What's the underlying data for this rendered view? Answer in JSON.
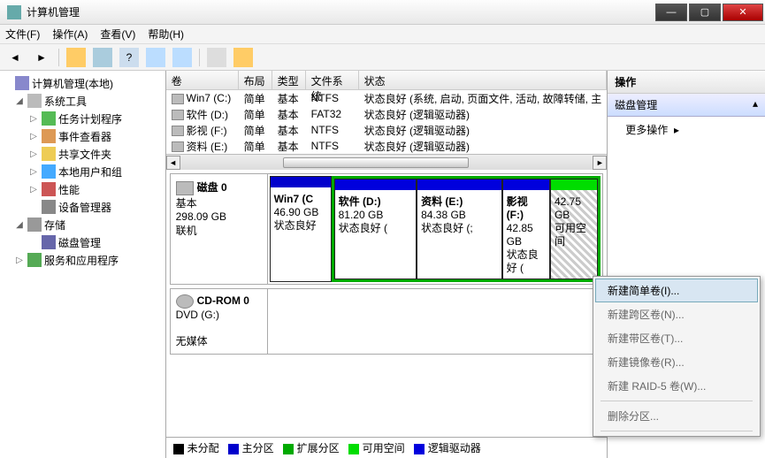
{
  "window": {
    "title": "计算机管理"
  },
  "menu": {
    "file": "文件(F)",
    "action": "操作(A)",
    "view": "查看(V)",
    "help": "帮助(H)"
  },
  "tree": {
    "root": "计算机管理(本地)",
    "system_tools": "系统工具",
    "scheduler": "任务计划程序",
    "events": "事件查看器",
    "shared": "共享文件夹",
    "users": "本地用户和组",
    "perf": "性能",
    "devmgr": "设备管理器",
    "storage": "存储",
    "diskmgmt": "磁盘管理",
    "services": "服务和应用程序"
  },
  "vol_headers": {
    "vol": "卷",
    "layout": "布局",
    "type": "类型",
    "fs": "文件系统",
    "status": "状态"
  },
  "volumes": [
    {
      "name": "Win7 (C:)",
      "layout": "简单",
      "type": "基本",
      "fs": "NTFS",
      "status": "状态良好 (系统, 启动, 页面文件, 活动, 故障转储, 主"
    },
    {
      "name": "软件 (D:)",
      "layout": "简单",
      "type": "基本",
      "fs": "FAT32",
      "status": "状态良好 (逻辑驱动器)"
    },
    {
      "name": "影视 (F:)",
      "layout": "简单",
      "type": "基本",
      "fs": "NTFS",
      "status": "状态良好 (逻辑驱动器)"
    },
    {
      "name": "资料 (E:)",
      "layout": "简单",
      "type": "基本",
      "fs": "NTFS",
      "status": "状态良好 (逻辑驱动器)"
    }
  ],
  "disk0": {
    "name": "磁盘 0",
    "kind": "基本",
    "size": "298.09 GB",
    "state": "联机",
    "parts": [
      {
        "label": "Win7  (C",
        "size": "46.90 GB",
        "status": "状态良好"
      },
      {
        "label": "软件  (D:)",
        "size": "81.20 GB",
        "status": "状态良好 ("
      },
      {
        "label": "资料  (E:)",
        "size": "84.38 GB",
        "status": "状态良好 (;"
      },
      {
        "label": "影视  (F:)",
        "size": "42.85 GB",
        "status": "状态良好 ("
      },
      {
        "label": "",
        "size": "42.75 GB",
        "status": "可用空间"
      }
    ]
  },
  "cdrom": {
    "name": "CD-ROM 0",
    "drive": "DVD (G:)",
    "state": "无媒体"
  },
  "legend": {
    "unalloc": "未分配",
    "primary": "主分区",
    "ext": "扩展分区",
    "free": "可用空间",
    "logical": "逻辑驱动器"
  },
  "actions": {
    "header": "操作",
    "diskmgmt": "磁盘管理",
    "more": "更多操作"
  },
  "ctx": {
    "simple": "新建简单卷(I)...",
    "span": "新建跨区卷(N)...",
    "stripe": "新建带区卷(T)...",
    "mirror": "新建镜像卷(R)...",
    "raid5": "新建 RAID-5 卷(W)...",
    "del": "删除分区..."
  }
}
